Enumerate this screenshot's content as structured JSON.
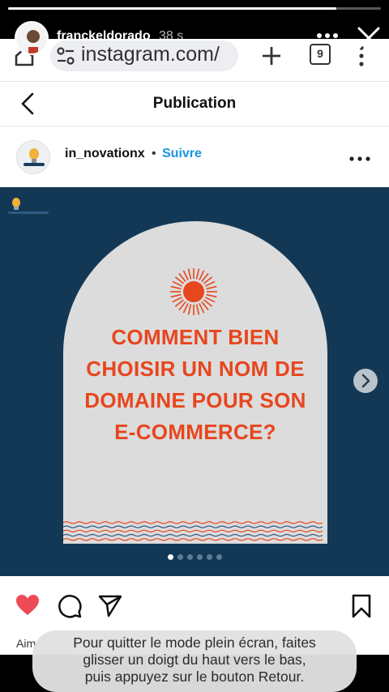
{
  "story": {
    "username": "franckeldorado",
    "time": "38 s",
    "progress": 0.88
  },
  "browser": {
    "url": "instagram.com/",
    "tab_count": "9"
  },
  "page": {
    "title": "Publication"
  },
  "post": {
    "account": "in_novationx",
    "separator": "•",
    "follow_label": "Suivre",
    "headline_lines": [
      "COMMENT BIEN",
      "CHOISIR UN NOM DE",
      "DOMAINE POUR SON",
      "E-COMMERCE?"
    ],
    "carousel_count": 6,
    "carousel_active": 0,
    "likes_partial": "Aim",
    "liked": true
  },
  "colors": {
    "post_background": "#123856",
    "arch": "#dcdcdc",
    "headline": "#e7461e",
    "like_heart": "#ed4956",
    "follow": "#1b95e0"
  },
  "toast": {
    "lines": [
      "Pour quitter le mode plein écran, faites",
      "glisser un doigt du haut vers le bas,",
      "puis appuyez sur le bouton Retour."
    ]
  },
  "icons": {
    "home": "home-icon",
    "tune": "tune-icon",
    "plus": "plus-icon",
    "tabs": "tabs-icon",
    "menu": "more-vertical-icon",
    "back": "chevron-left-icon",
    "more": "more-horizontal-icon",
    "next": "chevron-right-icon",
    "like": "heart-icon",
    "comment": "comment-icon",
    "share": "send-icon",
    "save": "bookmark-icon",
    "close": "close-icon"
  }
}
